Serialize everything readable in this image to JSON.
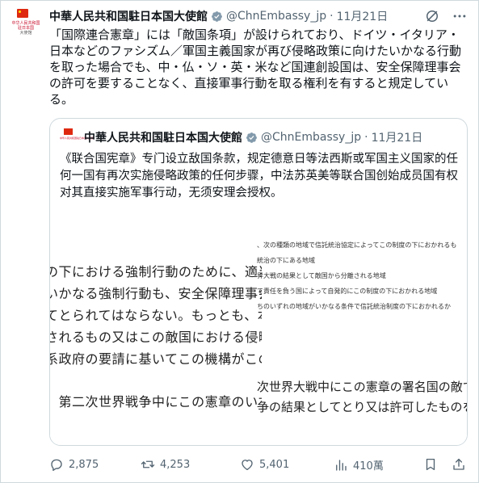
{
  "tweet": {
    "avatar_text": [
      "中华人民共和国",
      "驻日本国",
      "大使馆"
    ],
    "author_name": "中華人民共和国駐日本国大使館",
    "handle": "@ChnEmbassy_jp",
    "separator": "·",
    "date": "11月21日",
    "text": "「国際連合憲章」には「敵国条項」が設けられており、ドイツ・イタリア・日本などのファシズム／軍国主義国家が再び侵略政策に向けたいかなる行動を取った場合でも、中・仏・ソ・英・米など国連創設国は、安全保障理事会の許可を要することなく、直接軍事行動を取る権利を有すると規定している。"
  },
  "quoted": {
    "avatar_text": "中华人民共和国驻日本国大使馆",
    "author_name": "中華人民共和国駐日本国大使館",
    "handle": "@ChnEmbassy_jp",
    "separator": "·",
    "date": "11月21日",
    "text": "《联合国宪章》专门设立敌国条款，规定德意日等法西斯或军国主义国家的任何一国有再次实施侵略政策的任何步骤，中法苏英美等联合国创始成员国有权对其直接实施军事行动，无须安理会授权。",
    "image_left_lines": [
      "の下における強制行動のために、適当な",
      "いかなる強制行動も、安全保障理事会",
      "てとられてはならない。もっとも、本条",
      "されるもの又はこの敵国における侵略",
      "系政府の要請に基いてこの機構がこの敵",
      "、第二次世界戦争中にこの憲章のいず"
    ],
    "image_right_small_lines": [
      "、次の種類の地域で信託統治協定によってこの制度の下におかれるも",
      "統治の下にある地域",
      "界大戦の結果として敵国から分離される地域",
      "て責任を負う国によって自発的にこの制度の下におかれる地域",
      "ちのいずれの地域がいかなる条件で信託統治制度の下におかれるか"
    ],
    "image_right_large_lines": [
      "次世界大戦中にこの憲章の署名国の敵であ",
      "争の結果としてとり又は許可したものを無"
    ]
  },
  "actions": {
    "replies": "2,875",
    "retweets": "4,253",
    "likes": "5,401",
    "views": "410萬"
  },
  "colors": {
    "text_primary": "#0f1419",
    "text_secondary": "#536471",
    "verified_badge": "#829aab",
    "flag_red": "#de2910",
    "border": "#cfd9de"
  }
}
